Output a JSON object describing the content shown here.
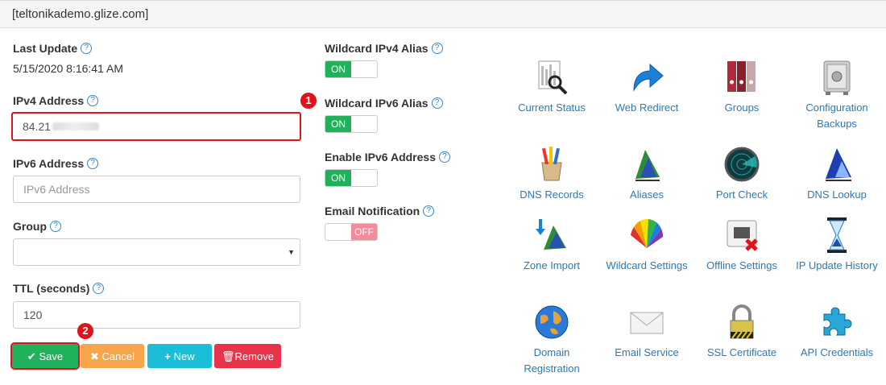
{
  "header": {
    "domain": "[teltonikademo.glize.com]"
  },
  "form": {
    "last_update_label": "Last Update",
    "last_update_value": "5/15/2020 8:16:41 AM",
    "ipv4_label": "IPv4 Address",
    "ipv4_value": "84.21",
    "ipv6_label": "IPv6 Address",
    "ipv6_placeholder": "IPv6 Address",
    "group_label": "Group",
    "ttl_label": "TTL (seconds)",
    "ttl_value": "120",
    "help_glyph": "?"
  },
  "buttons": {
    "save": "Save",
    "cancel": "Cancel",
    "new": "New",
    "remove": "Remove"
  },
  "toggles": [
    {
      "label": "Wildcard IPv4 Alias",
      "state": "ON"
    },
    {
      "label": "Wildcard IPv6 Alias",
      "state": "ON"
    },
    {
      "label": "Enable IPv6 Address",
      "state": "ON"
    },
    {
      "label": "Email Notification",
      "state": "OFF"
    }
  ],
  "annotations": {
    "one": "1",
    "two": "2"
  },
  "tools": [
    {
      "name": "Current Status",
      "icon": "report-magnifier-icon"
    },
    {
      "name": "Web Redirect",
      "icon": "blue-arrow-icon"
    },
    {
      "name": "Groups",
      "icon": "binders-icon"
    },
    {
      "name": "Configuration Backups",
      "icon": "safe-icon"
    },
    {
      "name": "DNS Records",
      "icon": "pencil-cup-icon"
    },
    {
      "name": "Aliases",
      "icon": "flag-icon"
    },
    {
      "name": "Port Check",
      "icon": "radar-icon"
    },
    {
      "name": "DNS Lookup",
      "icon": "blue-flag-icon"
    },
    {
      "name": "Zone Import",
      "icon": "flag-import-icon"
    },
    {
      "name": "Wildcard Settings",
      "icon": "color-fan-icon"
    },
    {
      "name": "Offline Settings",
      "icon": "offline-port-icon"
    },
    {
      "name": "IP Update History",
      "icon": "hourglass-icon"
    },
    {
      "name": "Domain Registration",
      "icon": "globe-icon"
    },
    {
      "name": "Email Service",
      "icon": "envelope-icon"
    },
    {
      "name": "SSL Certificate",
      "icon": "padlock-icon"
    },
    {
      "name": "API Credentials",
      "icon": "puzzle-icon"
    }
  ],
  "colors": {
    "save": "#1fb25a",
    "cancel": "#f7a54a",
    "new": "#1bbed6",
    "remove": "#e8334a",
    "highlight": "#e0131b",
    "link": "#2a7ab8"
  }
}
